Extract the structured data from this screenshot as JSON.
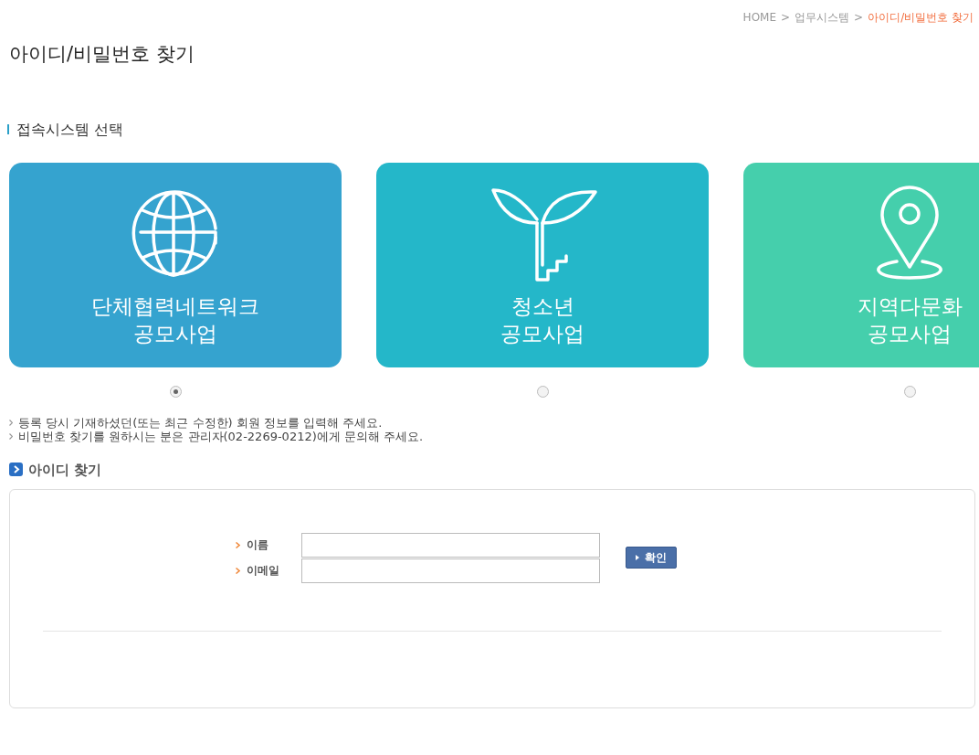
{
  "breadcrumb": [
    {
      "label": "HOME",
      "current": false
    },
    {
      "label": "업무시스템",
      "current": false
    },
    {
      "label": "아이디/비밀번호 찾기",
      "current": true
    }
  ],
  "breadcrumb_separator": ">",
  "page_title": "아이디/비밀번호 찾기",
  "section_title": "접속시스템 선택",
  "systems": [
    {
      "kind": "globe",
      "color": "#35a3cf",
      "line1": "단체협력네트워크",
      "line2": "공모사업",
      "selected": true
    },
    {
      "kind": "sprout",
      "color": "#24b7c9",
      "line1": "청소년",
      "line2": "공모사업",
      "selected": false
    },
    {
      "kind": "pin",
      "color": "#45cfac",
      "line1": "지역다문화",
      "line2": "공모사업",
      "selected": false
    }
  ],
  "notes": [
    "등록 당시 기재하셨던(또는 최근 수정한) 회원 정보를 입력해 주세요.",
    "비밀번호 찾기를 원하시는 분은 관리자(02-2269-0212)에게 문의해 주세요."
  ],
  "find_id": {
    "title": "아이디 찾기",
    "fields": [
      {
        "label": "이름"
      },
      {
        "label": "이메일"
      }
    ],
    "button": "확인"
  }
}
